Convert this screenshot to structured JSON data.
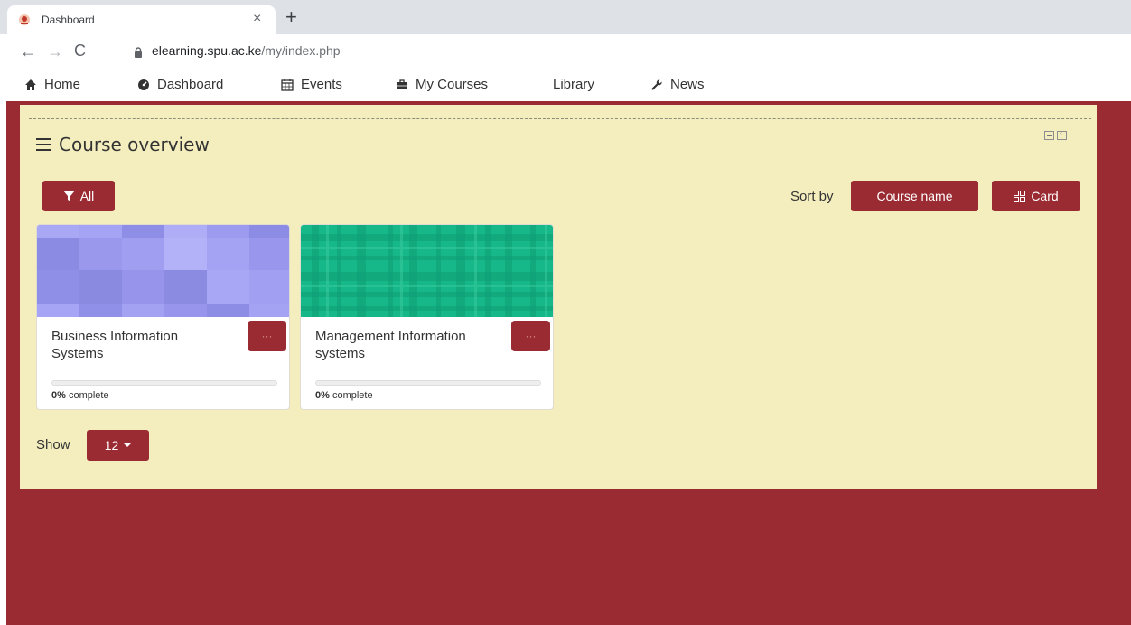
{
  "browser": {
    "tab_title": "Dashboard",
    "tab_close": "×",
    "new_tab": "+",
    "url_host": "elearning.spu.ac.ke",
    "url_path": "/my/index.php"
  },
  "sitenav": {
    "items": [
      {
        "label": "Home",
        "icon": "home-icon"
      },
      {
        "label": "Dashboard",
        "icon": "dashboard-icon"
      },
      {
        "label": "Events",
        "icon": "calendar-icon"
      },
      {
        "label": "My Courses",
        "icon": "briefcase-icon"
      },
      {
        "label": "Library",
        "icon": ""
      },
      {
        "label": "News",
        "icon": "wrench-icon"
      }
    ]
  },
  "block": {
    "title": "Course overview",
    "filter_label": "All",
    "sort_label": "Sort by",
    "sort_value": "Course name",
    "view_value": "Card",
    "show_label": "Show",
    "show_value": "12"
  },
  "courses": [
    {
      "name": "Business Information Systems",
      "progress": 0,
      "progress_pct": "0%",
      "complete_text": "complete",
      "menu": "···",
      "image_color": "#9b9af0"
    },
    {
      "name": "Management Information systems",
      "progress": 0,
      "progress_pct": "0%",
      "complete_text": "complete",
      "menu": "···",
      "image_color": "#16b88a"
    }
  ],
  "colors": {
    "brand": "#9a2b32",
    "block_bg": "#f4eebf"
  }
}
